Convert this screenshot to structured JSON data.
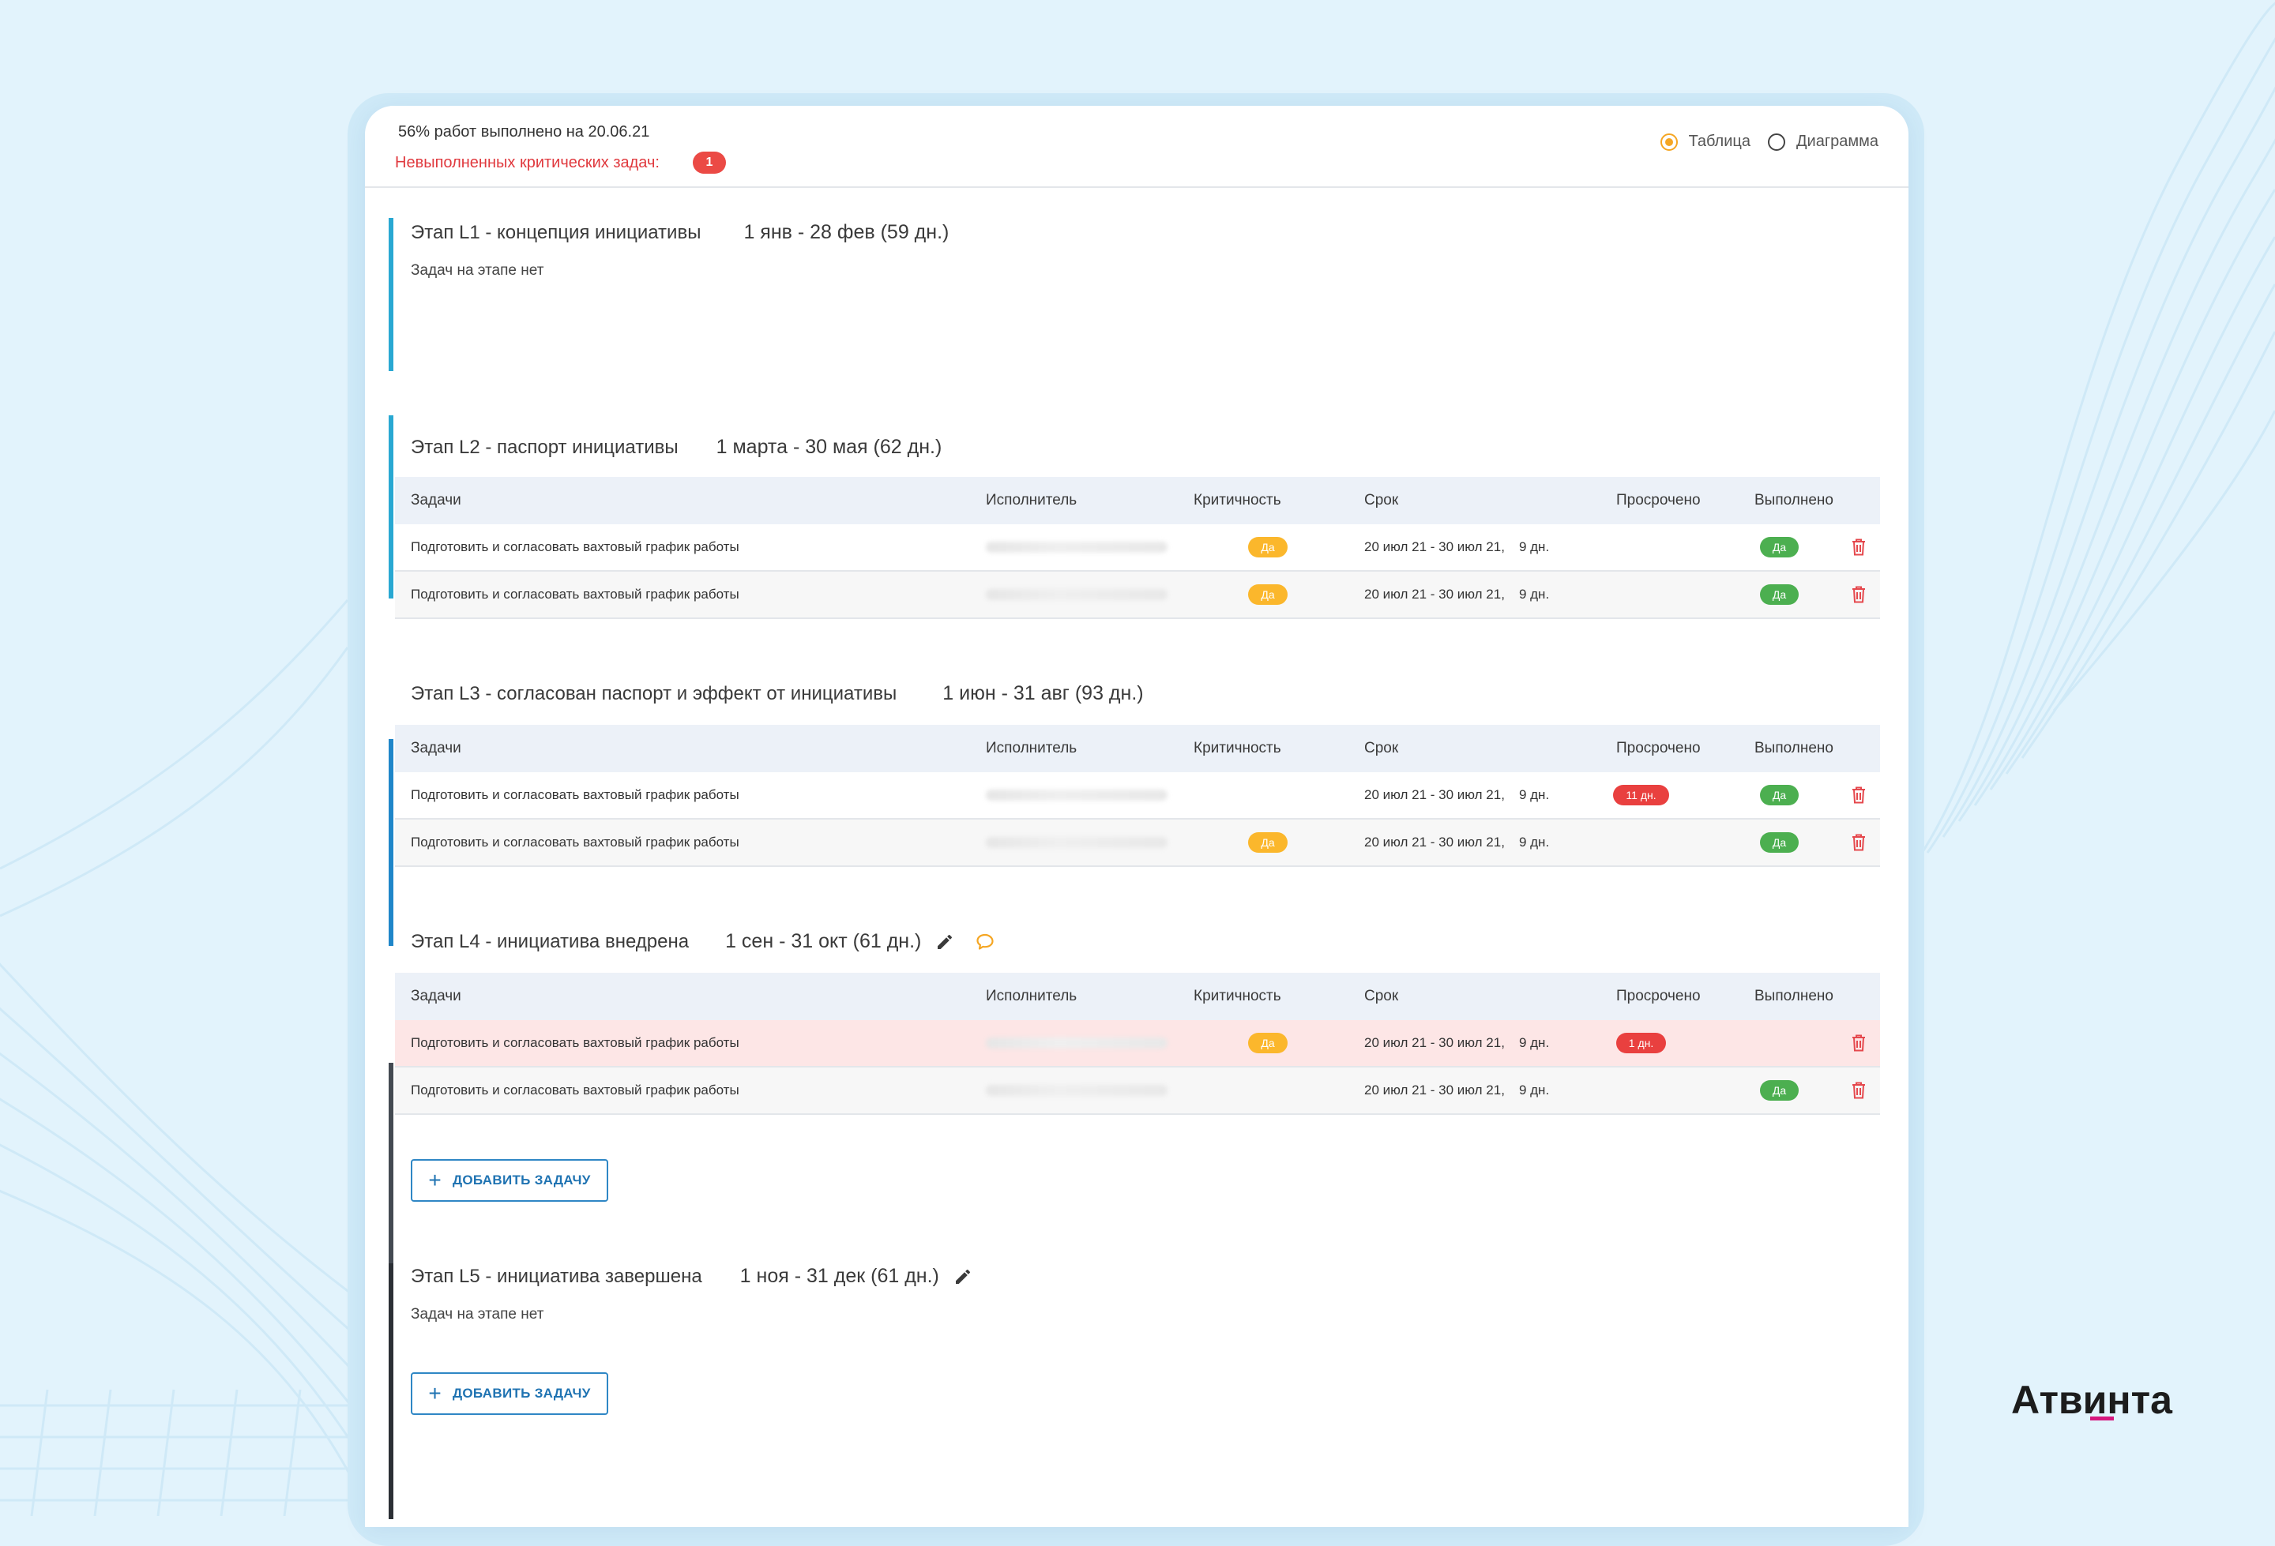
{
  "header": {
    "progress": "56% работ выполнено на 20.06.21",
    "critical_label": "Невыполненных критических задач:",
    "critical_count": "1",
    "view_options": [
      {
        "label": "Таблица",
        "selected": true
      },
      {
        "label": "Диаграмма",
        "selected": false
      }
    ]
  },
  "columns": {
    "task": "Задачи",
    "executor": "Исполнитель",
    "criticality": "Критичность",
    "due": "Срок",
    "overdue": "Просрочено",
    "done": "Выполнено"
  },
  "stages": [
    {
      "title": "Этап L1 - концепция инициативы",
      "dates": "1 янв - 28 фев (59 дн.)",
      "empty_text": "Задач на этапе нет",
      "bar_color": "#29a8d2"
    },
    {
      "title": "Этап L2 - паспорт инициативы",
      "dates": "1 марта - 30 мая  (62 дн.)",
      "bar_color": "#29a8d2",
      "rows": [
        {
          "task": "Подготовить и согласовать вахтовый график работы",
          "critical": "Да",
          "due": "20 июл 21 - 30 июл 21,",
          "days": "9 дн.",
          "overdue": "",
          "done": "Да"
        },
        {
          "task": "Подготовить и согласовать вахтовый график работы",
          "critical": "Да",
          "due": "20 июл 21 - 30 июл 21,",
          "days": "9 дн.",
          "overdue": "",
          "done": "Да"
        }
      ]
    },
    {
      "title": "Этап L3 - согласован паспорт и эффект от инициативы",
      "dates": "1 июн - 31 авг  (93 дн.)",
      "bar_color": "#1f86c9",
      "rows": [
        {
          "task": "Подготовить и согласовать вахтовый график работы",
          "critical": "",
          "due": "20 июл 21 - 30 июл 21,",
          "days": "9 дн.",
          "overdue": "11 дн.",
          "done": "Да"
        },
        {
          "task": "Подготовить и согласовать вахтовый график работы",
          "critical": "Да",
          "due": "20 июл 21 - 30 июл 21,",
          "days": "9 дн.",
          "overdue": "",
          "done": "Да"
        }
      ]
    },
    {
      "title": "Этап L4 - инициатива внедрена",
      "dates": "1 сен - 31 окт  (61 дн.)",
      "bar_color": "#444a52",
      "rows": [
        {
          "task": "Подготовить и согласовать вахтовый график работы",
          "critical": "Да",
          "due": "20 июл 21 - 30 июл 21,",
          "days": "9 дн.",
          "overdue": "1 дн.",
          "done": ""
        },
        {
          "task": "Подготовить и согласовать вахтовый график работы",
          "critical": "",
          "due": "20 июл 21 - 30 июл 21,",
          "days": "9 дн.",
          "overdue": "",
          "done": "Да"
        }
      ],
      "add_label": "ДОБАВИТЬ ЗАДАЧУ"
    },
    {
      "title": "Этап L5 - инициатива завершена",
      "dates": "1 ноя - 31 дек  (61 дн.)",
      "empty_text": "Задач на этапе нет",
      "bar_color": "#2b2f35",
      "add_label": "ДОБАВИТЬ ЗАДАЧУ"
    }
  ],
  "brand": "Атвинта",
  "colors": {
    "accent_blue": "#2f87c5",
    "critical_red": "#e9403f",
    "yes_green": "#4caf50",
    "yes_yellow": "#fbb72c",
    "radio_orange": "#f5a623"
  }
}
